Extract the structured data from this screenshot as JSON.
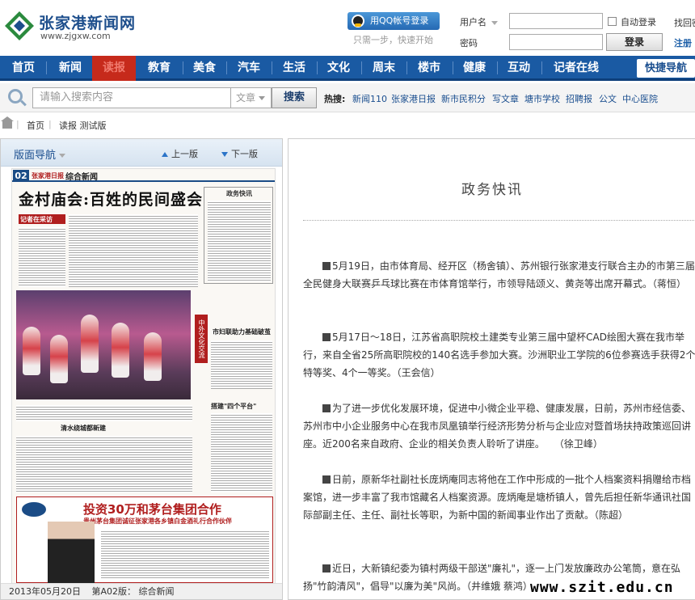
{
  "header": {
    "site_name": "张家港新闻网",
    "site_url": "www.zjgxw.com",
    "qq_login": "用QQ帐号登录",
    "qq_tip": "只需一步，快速开始",
    "username_label": "用户名",
    "password_label": "密码",
    "auto_login": "自动登录",
    "login_button": "登录",
    "find_password": "找回密",
    "register": "注册"
  },
  "nav": {
    "items": [
      "首页",
      "新闻",
      "读报",
      "教育",
      "美食",
      "汽车",
      "生活",
      "文化",
      "周末",
      "楼市",
      "健康",
      "互动",
      "记者在线"
    ],
    "active_index": 2,
    "quick_nav": "快捷导航"
  },
  "search": {
    "placeholder": "请输入搜索内容",
    "type": "文章",
    "button": "搜索",
    "hot_label": "热搜:",
    "hot_links": [
      "新闻110",
      "张家港日报",
      "新市民积分",
      "写文章",
      "塘市学校",
      "招聘报",
      "公文",
      "中心医院"
    ]
  },
  "breadcrumb": {
    "home": "首页",
    "current": "读报 测试版"
  },
  "left_panel": {
    "title": "版面导航",
    "prev": "上一版",
    "next": "下一版",
    "page_num": "02",
    "paper_name": "张家港日报",
    "section": "综合新闻",
    "headline": "金村庙会:百姓的民间盛会",
    "reporter_tag": "记者在采访",
    "side_box_title": "政务快讯",
    "vertical_tag": "中外文化交流",
    "sub_head_1": "市妇联助力基础破茧",
    "sub_head_2": "清水绕城都新建",
    "sub_head_3": "搭建\"四个平台\"",
    "ad_title": "投资30万和茅台集团合作",
    "ad_subtitle": "贵州茅台集团诚征张家港各乡镇白金酒礼行合作伙伴",
    "footer_date": "2013年05月20日",
    "footer_page": "第A02版：",
    "footer_section": "综合新闻"
  },
  "article": {
    "title": "政务快讯",
    "paragraphs": [
      "5月19日，由市体育局、经开区（杨舍镇）、苏州银行张家港支行联合主办的市第三届全民健身大联赛乒乓球比赛在市体育馆举行，市领导陆颂义、黄尧等出席开幕式。（蒋恒）",
      "5月17日～18日，江苏省高职院校土建类专业第三届中望杯CAD绘图大赛在我市举行，来自全省25所高职院校的140名选手参加大赛。沙洲职业工学院的6位参赛选手获得2个特等奖、4个一等奖。（王会信）",
      "为了进一步优化发展环境，促进中小微企业平稳、健康发展，日前，苏州市经信委、苏州市中小企业服务中心在我市凤凰镇举行经济形势分析与企业应对暨首场扶持政策巡回讲座。近200名来自政府、企业的相关负责人聆听了讲座。　　（徐卫峰）",
      "日前，原新华社副社长庞炳庵同志将他在工作中形成的一批个人档案资料捐赠给市档案馆，进一步丰富了我市馆藏名人档案资源。庞炳庵是塘桥镇人，曾先后担任新华通讯社国际部副主任、主任、副社长等职，为新中国的新闻事业作出了贡献。（陈超）",
      "近日，大新镇纪委为镇村两级干部送\"廉礼\"，逐一上门发放廉政办公笔筒，意在弘扬\"竹韵清风\"，倡导\"以廉为美\"风尚。（井维娥 蔡鸿）"
    ]
  },
  "watermark": "www.szit.edu.cn",
  "colors": {
    "nav_bg": "#1a5aa3",
    "nav_active": "#c62a1b",
    "link": "#1a4e8f"
  }
}
